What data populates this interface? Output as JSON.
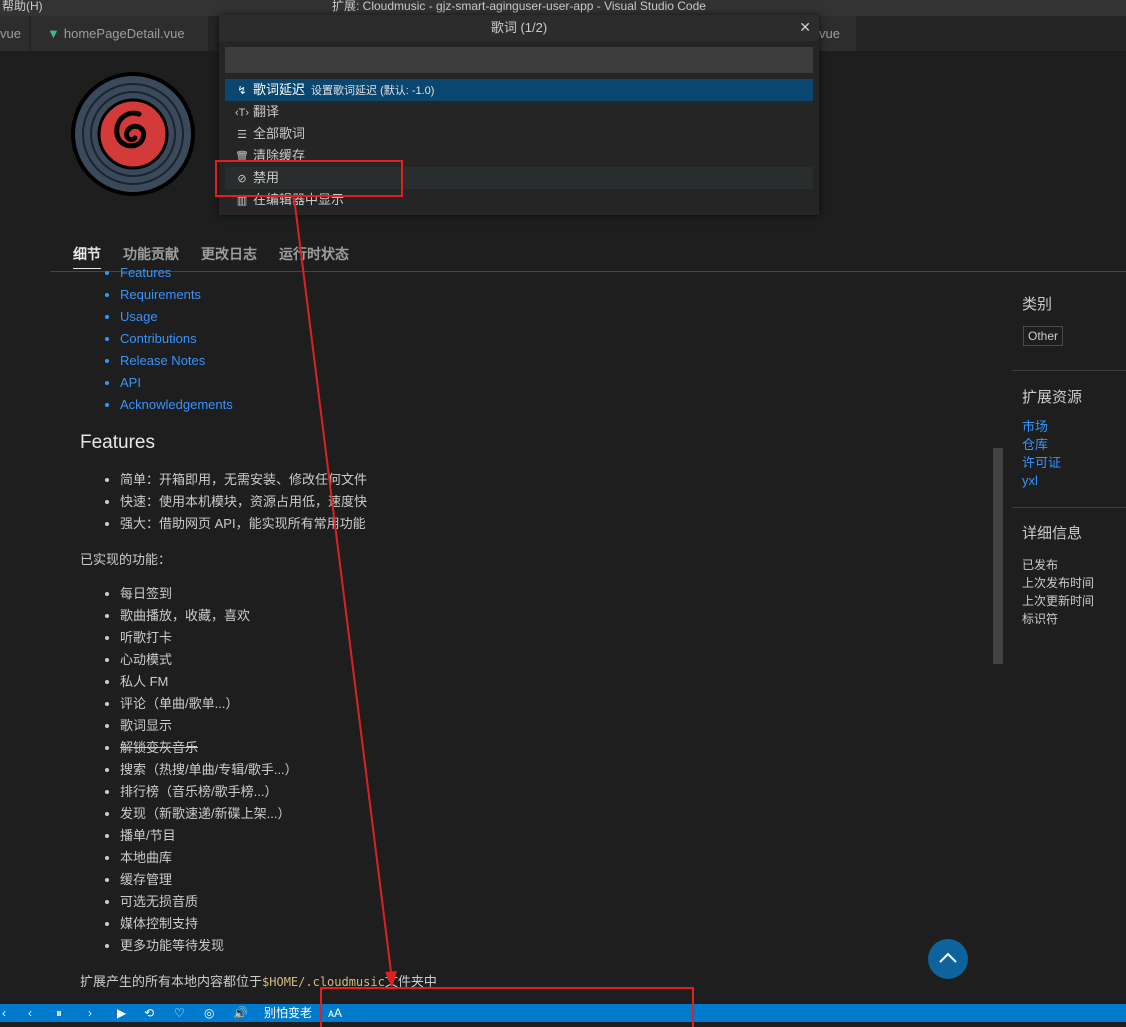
{
  "window": {
    "menu": "帮助(H)",
    "title": "扩展: Cloudmusic - gjz-smart-aginguser-user-app - Visual Studio Code"
  },
  "tabs": [
    {
      "label": "vue"
    },
    {
      "label": "homePageDetail.vue"
    },
    {
      "label": "vue"
    }
  ],
  "detail_tabs": [
    "细节",
    "功能贡献",
    "更改日志",
    "运行时状态"
  ],
  "readme": {
    "toc": [
      "Features",
      "Requirements",
      "Usage",
      "Contributions",
      "Release Notes",
      "API",
      "Acknowledgements"
    ],
    "features_heading": "Features",
    "feature_points": [
      "简单：开箱即用，无需安装、修改任何文件",
      "快速：使用本机模块，资源占用低，速度快",
      "强大：借助网页 API，能实现所有常用功能"
    ],
    "implemented_label": "已实现的功能：",
    "implemented": [
      "每日签到",
      "歌曲播放，收藏，喜欢",
      "听歌打卡",
      "心动模式",
      "私人 FM",
      "评论（单曲/歌单...）",
      "歌词显示",
      "解锁变灰音乐",
      "搜索（热搜/单曲/专辑/歌手...）",
      "排行榜（音乐榜/歌手榜...）",
      "发现（新歌速递/新碟上架...）",
      "播单/节目",
      "本地曲库",
      "缓存管理",
      "可选无损音质",
      "媒体控制支持",
      "更多功能等待发现"
    ],
    "footer_prefix": "扩展产生的所有本地内容都位于",
    "footer_code": "$HOME/.cloudmusic",
    "footer_suffix": "文件夹中"
  },
  "sidebar": {
    "category_heading": "类别",
    "category_badge": "Other",
    "resources_heading": "扩展资源",
    "resources": [
      "市场",
      "仓库",
      "许可证",
      "yxl"
    ],
    "details_heading": "详细信息",
    "details": [
      "已发布",
      "上次发布时间",
      "上次更新时间",
      "标识符"
    ]
  },
  "quickpick": {
    "title": "歌词 (1/2)",
    "close": "✕",
    "input_value": "",
    "items": [
      {
        "icon": "↯",
        "label": "歌词延迟",
        "desc": "设置歌词延迟 (默认: -1.0)",
        "selected": true
      },
      {
        "icon": "‹T›",
        "label": "翻译",
        "desc": ""
      },
      {
        "icon": "☰",
        "label": "全部歌词",
        "desc": ""
      },
      {
        "icon": "🗑",
        "label": "清除缓存",
        "desc": ""
      },
      {
        "icon": "⊘",
        "label": "禁用",
        "desc": ""
      },
      {
        "icon": "▥",
        "label": "在编辑器中显示",
        "desc": ""
      }
    ]
  },
  "statusbar": {
    "items": [
      "‹",
      "⏸",
      "›",
      "▶",
      "⟲",
      "♡",
      "◎",
      "🔊",
      "别怕变老",
      "ᴀA"
    ]
  }
}
